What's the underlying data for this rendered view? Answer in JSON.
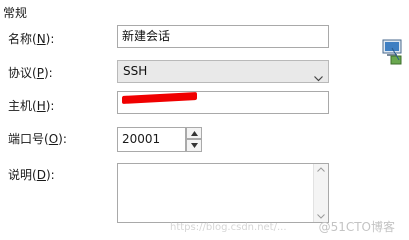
{
  "section": {
    "title": "常规"
  },
  "fields": {
    "name": {
      "label_pre": "名称(",
      "key": "N",
      "label_post": "):",
      "value": "新建会话"
    },
    "protocol": {
      "label_pre": "协议(",
      "key": "P",
      "label_post": "):",
      "value": "SSH"
    },
    "host": {
      "label_pre": "主机(",
      "key": "H",
      "label_post": "):",
      "value": "",
      "redacted": true
    },
    "port": {
      "label_pre": "端口号(",
      "key": "O",
      "label_post": "):",
      "value": "20001"
    },
    "description": {
      "label_pre": "说明(",
      "key": "D",
      "label_post": "):",
      "value": ""
    }
  },
  "watermark": {
    "text": "@51CTO博客",
    "faint_text": "https://blog.csdn.net/..."
  },
  "icons": {
    "protocol_dropdown": "chevron-down-icon",
    "port_up": "spin-up-icon",
    "port_down": "spin-down-icon",
    "scroll_up": "scroll-up-icon",
    "scroll_down": "scroll-down-icon",
    "network": "network-computer-icon"
  },
  "colors": {
    "redaction": "#f00000",
    "select_bg": "#e9e9e9",
    "border": "#a9a9a9"
  }
}
